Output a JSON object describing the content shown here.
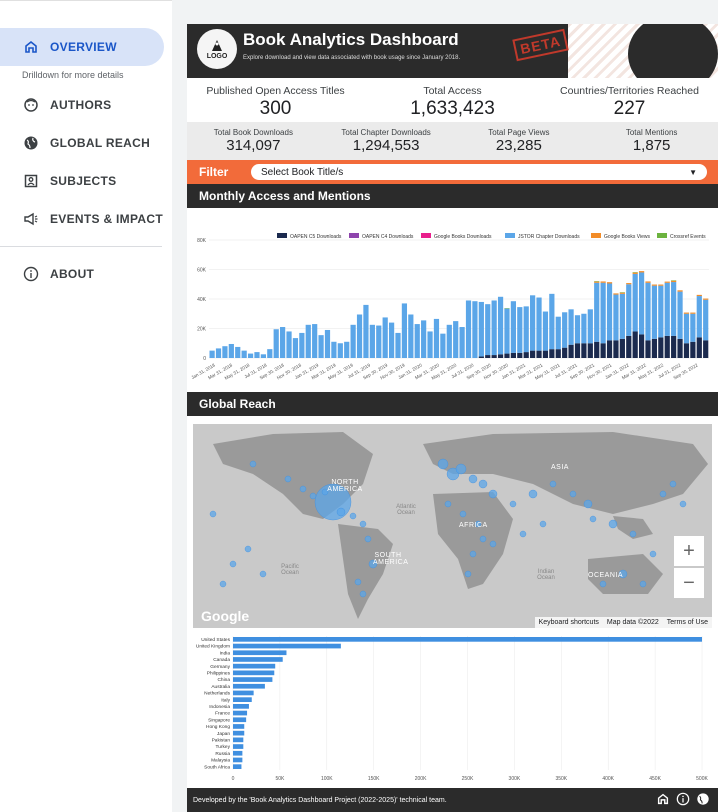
{
  "sidebar": {
    "items": [
      {
        "label": "OVERVIEW",
        "icon": "home-icon",
        "active": true
      },
      {
        "label": "AUTHORS",
        "icon": "face-icon"
      },
      {
        "label": "GLOBAL REACH",
        "icon": "globe-icon"
      },
      {
        "label": "SUBJECTS",
        "icon": "subject-icon"
      },
      {
        "label": "EVENTS & IMPACT",
        "icon": "megaphone-icon"
      },
      {
        "label": "ABOUT",
        "icon": "info-icon"
      }
    ],
    "subtext": "Drilldown for more details"
  },
  "header": {
    "logo": "LOGO",
    "title": "Book Analytics Dashboard",
    "subtitle": "Explore download and view data associated with book usage since January 2018.",
    "stamp": "BETA"
  },
  "stats_primary": [
    {
      "label": "Published Open Access Titles",
      "value": "300"
    },
    {
      "label": "Total Access",
      "value": "1,633,423"
    },
    {
      "label": "Countries/Territories Reached",
      "value": "227"
    }
  ],
  "stats_secondary": [
    {
      "label": "Total Book Downloads",
      "value": "314,097"
    },
    {
      "label": "Total Chapter Downloads",
      "value": "1,294,553"
    },
    {
      "label": "Total Page Views",
      "value": "23,285"
    },
    {
      "label": "Total Mentions",
      "value": "1,875"
    }
  ],
  "filter": {
    "label": "Filter",
    "placeholder": "Select Book Title/s"
  },
  "sections": {
    "monthly": "Monthly Access and Mentions",
    "global": "Global Reach"
  },
  "map": {
    "continents": [
      "NORTH AMERICA",
      "SOUTH AMERICA",
      "AFRICA",
      "ASIA",
      "OCEANIA"
    ],
    "oceans": [
      "Atlantic Ocean",
      "Pacific Ocean",
      "Indian Ocean"
    ],
    "google": "Google",
    "keyboard_shortcuts": "Keyboard shortcuts",
    "map_data": "Map data ©2022",
    "terms": "Terms of Use",
    "zoom_in": "+",
    "zoom_out": "−"
  },
  "footer": {
    "text": "Developed by the 'Book Analytics Dashboard Project (2022-2025)' technical team."
  },
  "colors": {
    "accent_orange": "#f26b3a",
    "dark": "#2b2b2b",
    "jstor": "#5ba6e8",
    "oapen_c5": "#1b2a4e",
    "oapen_c4": "#8e44ad",
    "google_books_dl": "#e91e8c",
    "google_books_views": "#f28c28",
    "crossref": "#6cb33f",
    "country_bar": "#3f8fe0"
  },
  "chart_data": [
    {
      "type": "bar",
      "stacked": true,
      "legend": [
        "OAPEN C5 Downloads",
        "OAPEN C4 Downloads",
        "Google Books Downloads",
        "JSTOR Chapter Downloads",
        "Google Books Views",
        "Crossref Events"
      ],
      "yticks": [
        "0",
        "20K",
        "40K",
        "60K",
        "80K"
      ],
      "ylim": [
        0,
        80000
      ],
      "xticks": [
        "Jan 31, 2018",
        "Mar 31, 2018",
        "May 31, 2018",
        "Jul 31, 2018",
        "Sep 30, 2018",
        "Nov 30, 2018",
        "Jan 31, 2019",
        "Mar 31, 2019",
        "May 31, 2019",
        "Jul 31, 2019",
        "Sep 30, 2019",
        "Nov 30, 2019",
        "Jan 31, 2020",
        "Mar 31, 2020",
        "May 31, 2020",
        "Jul 31, 2020",
        "Sep 30, 2020",
        "Nov 30, 2020",
        "Jan 31, 2021",
        "Mar 31, 2021",
        "May 31, 2021",
        "Jul 31, 2021",
        "Sep 30, 2021",
        "Nov 30, 2021",
        "Jan 31, 2022",
        "Mar 31, 2022",
        "May 31, 2022",
        "Jul 31, 2022",
        "Sep 30, 2022"
      ],
      "series": [
        {
          "name": "OAPEN C5 Downloads",
          "values": [
            0,
            0,
            0,
            0,
            0,
            0,
            0,
            0,
            0,
            0,
            0,
            0,
            0,
            0,
            0,
            0,
            0,
            0,
            0,
            0,
            0,
            0,
            0,
            0,
            0,
            0,
            0,
            0,
            0,
            0,
            0,
            0,
            0,
            0,
            0,
            0,
            0,
            0,
            0,
            0,
            0,
            0,
            1000,
            2000,
            2000,
            2500,
            3000,
            3500,
            3500,
            4000,
            5000,
            5000,
            5000,
            6000,
            6000,
            7000,
            9000,
            10000,
            10000,
            10000,
            11000,
            10000,
            12000,
            12000,
            13000,
            15000,
            18000,
            16000,
            12000,
            13000,
            14000,
            15000,
            15000,
            13000,
            10000,
            11000,
            14000,
            12000
          ]
        },
        {
          "name": "OAPEN C4 Downloads",
          "values": [
            0,
            0,
            0,
            0,
            0,
            0,
            0,
            0,
            0,
            0,
            0,
            0,
            0,
            0,
            0,
            0,
            0,
            0,
            0,
            0,
            0,
            0,
            0,
            0,
            0,
            0,
            0,
            0,
            0,
            0,
            0,
            0,
            0,
            0,
            0,
            0,
            0,
            0,
            0,
            0,
            0,
            0,
            0,
            0,
            0,
            0,
            0,
            0,
            0,
            0,
            0,
            0,
            0,
            0,
            0,
            0,
            0,
            0,
            0,
            0,
            0,
            0,
            0,
            0,
            0,
            0,
            0,
            0,
            0,
            0,
            0,
            0,
            0,
            0,
            0,
            0,
            0,
            0
          ]
        },
        {
          "name": "Google Books Downloads",
          "values": [
            0,
            0,
            0,
            0,
            0,
            0,
            0,
            0,
            0,
            0,
            0,
            0,
            0,
            0,
            0,
            0,
            0,
            0,
            0,
            0,
            0,
            0,
            0,
            0,
            0,
            0,
            0,
            0,
            0,
            0,
            0,
            0,
            0,
            0,
            0,
            0,
            0,
            0,
            0,
            0,
            0,
            0,
            0,
            0,
            0,
            0,
            0,
            0,
            0,
            0,
            0,
            0,
            0,
            0,
            0,
            0,
            0,
            0,
            0,
            0,
            0,
            0,
            0,
            0,
            0,
            0,
            0,
            0,
            0,
            0,
            0,
            0,
            0,
            0,
            0,
            0,
            0,
            0
          ]
        },
        {
          "name": "JSTOR Chapter Downloads",
          "values": [
            5000,
            6500,
            8000,
            9500,
            7500,
            5000,
            3000,
            4000,
            2500,
            6000,
            19500,
            21000,
            18000,
            13500,
            17000,
            22500,
            23000,
            15500,
            19000,
            11000,
            10000,
            11000,
            22500,
            29500,
            36000,
            22500,
            22000,
            27500,
            24000,
            17000,
            37000,
            29500,
            23000,
            25500,
            18000,
            26500,
            16500,
            22500,
            25000,
            21000,
            39000,
            38500,
            37000,
            34500,
            37000,
            39000,
            30500,
            35000,
            31000,
            31000,
            37500,
            36000,
            26500,
            37500,
            22000,
            24000,
            24000,
            19000,
            20000,
            23000,
            40000,
            41000,
            38500,
            31000,
            30500,
            35000,
            39000,
            42000,
            39000,
            36000,
            35000,
            36000,
            36500,
            32000,
            20000,
            19000,
            28000,
            27500
          ]
        },
        {
          "name": "Google Books Views",
          "values": [
            0,
            0,
            0,
            0,
            0,
            0,
            0,
            0,
            0,
            0,
            0,
            0,
            0,
            0,
            0,
            0,
            0,
            0,
            0,
            0,
            0,
            0,
            0,
            0,
            0,
            0,
            0,
            0,
            0,
            0,
            0,
            0,
            0,
            0,
            0,
            0,
            0,
            0,
            0,
            0,
            0,
            0,
            0,
            0,
            0,
            0,
            0,
            0,
            0,
            0,
            0,
            0,
            0,
            0,
            0,
            0,
            0,
            0,
            0,
            0,
            800,
            900,
            900,
            800,
            800,
            800,
            900,
            900,
            900,
            800,
            800,
            800,
            900,
            900,
            800,
            800,
            800,
            800
          ]
        },
        {
          "name": "Crossref Events",
          "values": [
            0,
            0,
            0,
            0,
            0,
            0,
            0,
            0,
            0,
            0,
            0,
            0,
            0,
            0,
            0,
            0,
            0,
            0,
            0,
            0,
            0,
            0,
            0,
            0,
            0,
            0,
            0,
            0,
            0,
            0,
            0,
            0,
            0,
            0,
            0,
            0,
            0,
            0,
            0,
            0,
            0,
            0,
            0,
            0,
            0,
            0,
            300,
            0,
            0,
            0,
            0,
            0,
            0,
            0,
            0,
            0,
            0,
            0,
            0,
            0,
            300,
            0,
            0,
            0,
            300,
            0,
            300,
            0,
            0,
            0,
            0,
            0,
            300,
            0,
            0,
            0,
            0,
            0
          ]
        }
      ]
    },
    {
      "type": "bar",
      "orientation": "horizontal",
      "categories": [
        "United States",
        "United Kingdom",
        "India",
        "Canada",
        "Germany",
        "Philippines",
        "China",
        "Australia",
        "Netherlands",
        "Italy",
        "Indonesia",
        "France",
        "Singapore",
        "Hong Kong",
        "Japan",
        "Pakistan",
        "Turkey",
        "Russia",
        "Malaysia",
        "South Africa"
      ],
      "values": [
        500000,
        115000,
        57000,
        53000,
        45000,
        44000,
        42000,
        34000,
        22000,
        20000,
        17000,
        15000,
        14000,
        12000,
        12000,
        11000,
        11000,
        10000,
        10000,
        9000
      ],
      "xticks": [
        "0",
        "50K",
        "100K",
        "150K",
        "200K",
        "250K",
        "300K",
        "350K",
        "400K",
        "450K",
        "500K"
      ],
      "xlim": [
        0,
        500000
      ]
    }
  ]
}
